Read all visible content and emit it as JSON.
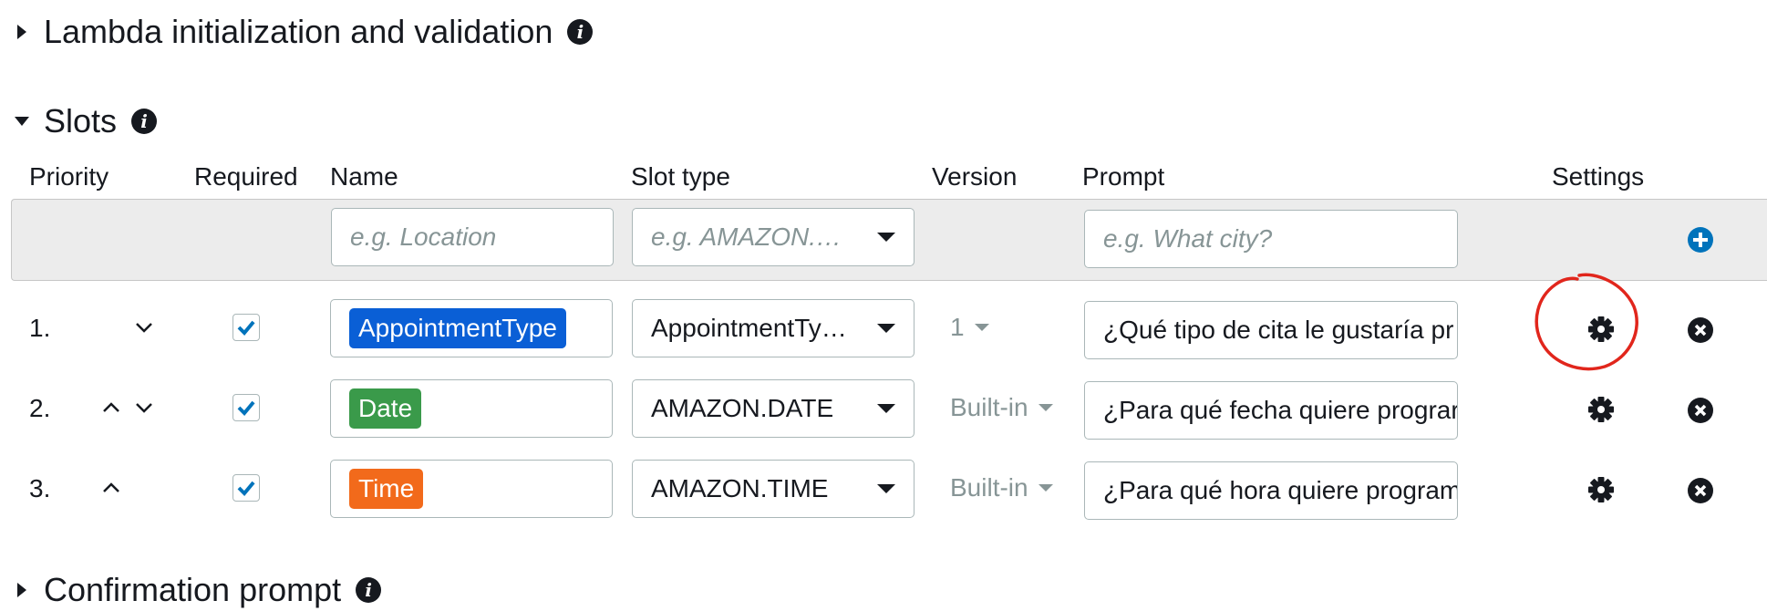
{
  "sections": {
    "lambda": {
      "title": "Lambda initialization and validation"
    },
    "slots": {
      "title": "Slots"
    },
    "confirmation": {
      "title": "Confirmation prompt"
    }
  },
  "columns": {
    "priority": "Priority",
    "required": "Required",
    "name": "Name",
    "slot_type": "Slot type",
    "version": "Version",
    "prompt": "Prompt",
    "settings": "Settings"
  },
  "new_slot": {
    "name_placeholder": "e.g. Location",
    "slot_type_placeholder": "e.g. AMAZON.…",
    "prompt_placeholder": "e.g. What city?"
  },
  "slots": [
    {
      "priority": "1.",
      "required": true,
      "name": "AppointmentType",
      "name_color": "#0a5fd6",
      "slot_type": "AppointmentTy…",
      "version": "1",
      "prompt": "¿Qué tipo de cita le gustaría pr"
    },
    {
      "priority": "2.",
      "required": true,
      "name": "Date",
      "name_color": "#3a9a4a",
      "slot_type": "AMAZON.DATE",
      "version": "Built-in",
      "prompt": "¿Para qué fecha quiere prograr"
    },
    {
      "priority": "3.",
      "required": true,
      "name": "Time",
      "name_color": "#f26a1b",
      "slot_type": "AMAZON.TIME",
      "version": "Built-in",
      "prompt": "¿Para qué hora quiere program"
    }
  ],
  "colors": {
    "accent": "#0073bb",
    "annotation": "#e1261c",
    "checkbox": "#0073bb"
  }
}
